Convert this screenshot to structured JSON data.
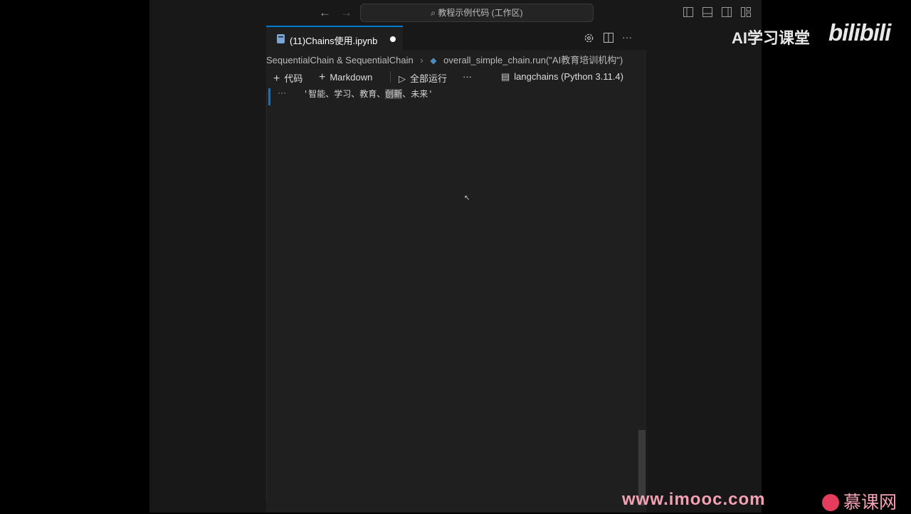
{
  "titlebar": {
    "search_text": "⌕ 教程示例代码 (工作区)",
    "back_icon": "arrow-left-icon",
    "forward_icon": "arrow-right-icon"
  },
  "tab": {
    "title": "(11)Chains使用.ipynb",
    "modified": true
  },
  "breadcrumb": {
    "section": "SequentialChain & SequentialChain",
    "item": "overall_simple_chain.run(\"AI教育培训机构\")"
  },
  "toolbar": {
    "add_code": "代码",
    "add_markdown": "Markdown",
    "run_all": "全部运行",
    "more": "···",
    "kernel": "langchains (Python 3.11.4)"
  },
  "output": {
    "dots": "···",
    "text_before": "'智能、学习、教育、",
    "text_highlight": "创新",
    "text_after": "、未来'"
  },
  "watermark": {
    "channel": "AI学习课堂",
    "site_logo": "bilibili",
    "url": "www.imooc.com",
    "brand": "慕课网"
  },
  "colors": {
    "accent": "#0078d4",
    "watermark": "#f3a2b5"
  }
}
